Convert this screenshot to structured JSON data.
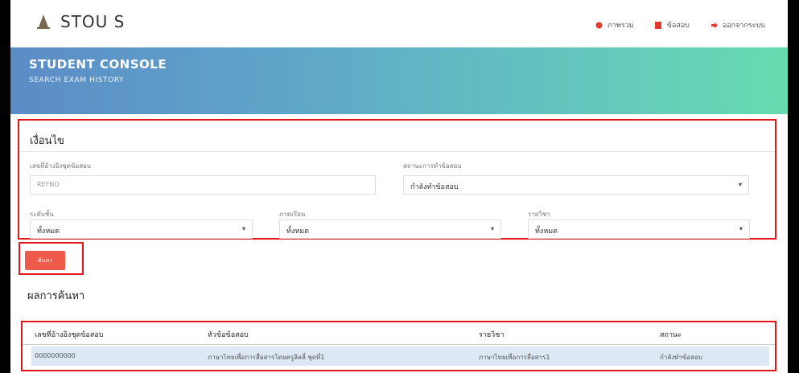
{
  "brand": {
    "name": "STOU S"
  },
  "nav": {
    "overview": "ภาพรวม",
    "exam": "ข้อสอบ",
    "logout": "ออกจากระบบ"
  },
  "header": {
    "title": "STUDENT CONSOLE",
    "subtitle": "SEARCH EXAM HISTORY"
  },
  "conditions": {
    "heading": "เงื่อนไข",
    "ref_label": "เลขที่อ้างอิงชุดข้อสอบ",
    "ref_placeholder": "REFNO",
    "status_label": "สถานะการทำข้อสอบ",
    "status_value": "กำลังทำข้อสอบ",
    "level_label": "ระดับชั้น",
    "level_value": "ทั้งหมด",
    "term_label": "ภาคเรียน",
    "term_value": "ทั้งหมด",
    "subject_label": "รายวิชา",
    "subject_value": "ทั้งหมด"
  },
  "search_button": "ค้นหา",
  "results": {
    "heading": "ผลการค้นหา",
    "columns": [
      "เลขที่อ้างอิงชุดข้อสอบ",
      "หัวข้อข้อสอบ",
      "รายวิชา",
      "สถานะ"
    ],
    "rows": [
      [
        "0000000000",
        "ภาษาไทยเพื่อการสื่อสารโดยครูลิลลี่ ชุดที่1",
        "ภาษาไทยเพื่อการสื่อสาร1",
        "กำลังทำข้อสอบ"
      ]
    ]
  },
  "colors": {
    "accent_red": "#e3161b",
    "button": "#f05a4a",
    "row_highlight": "#dce9f5"
  },
  "icons": {
    "brand": "stupa-icon",
    "overview": "dashboard-icon",
    "exam": "file-icon",
    "logout": "sign-out-icon"
  }
}
